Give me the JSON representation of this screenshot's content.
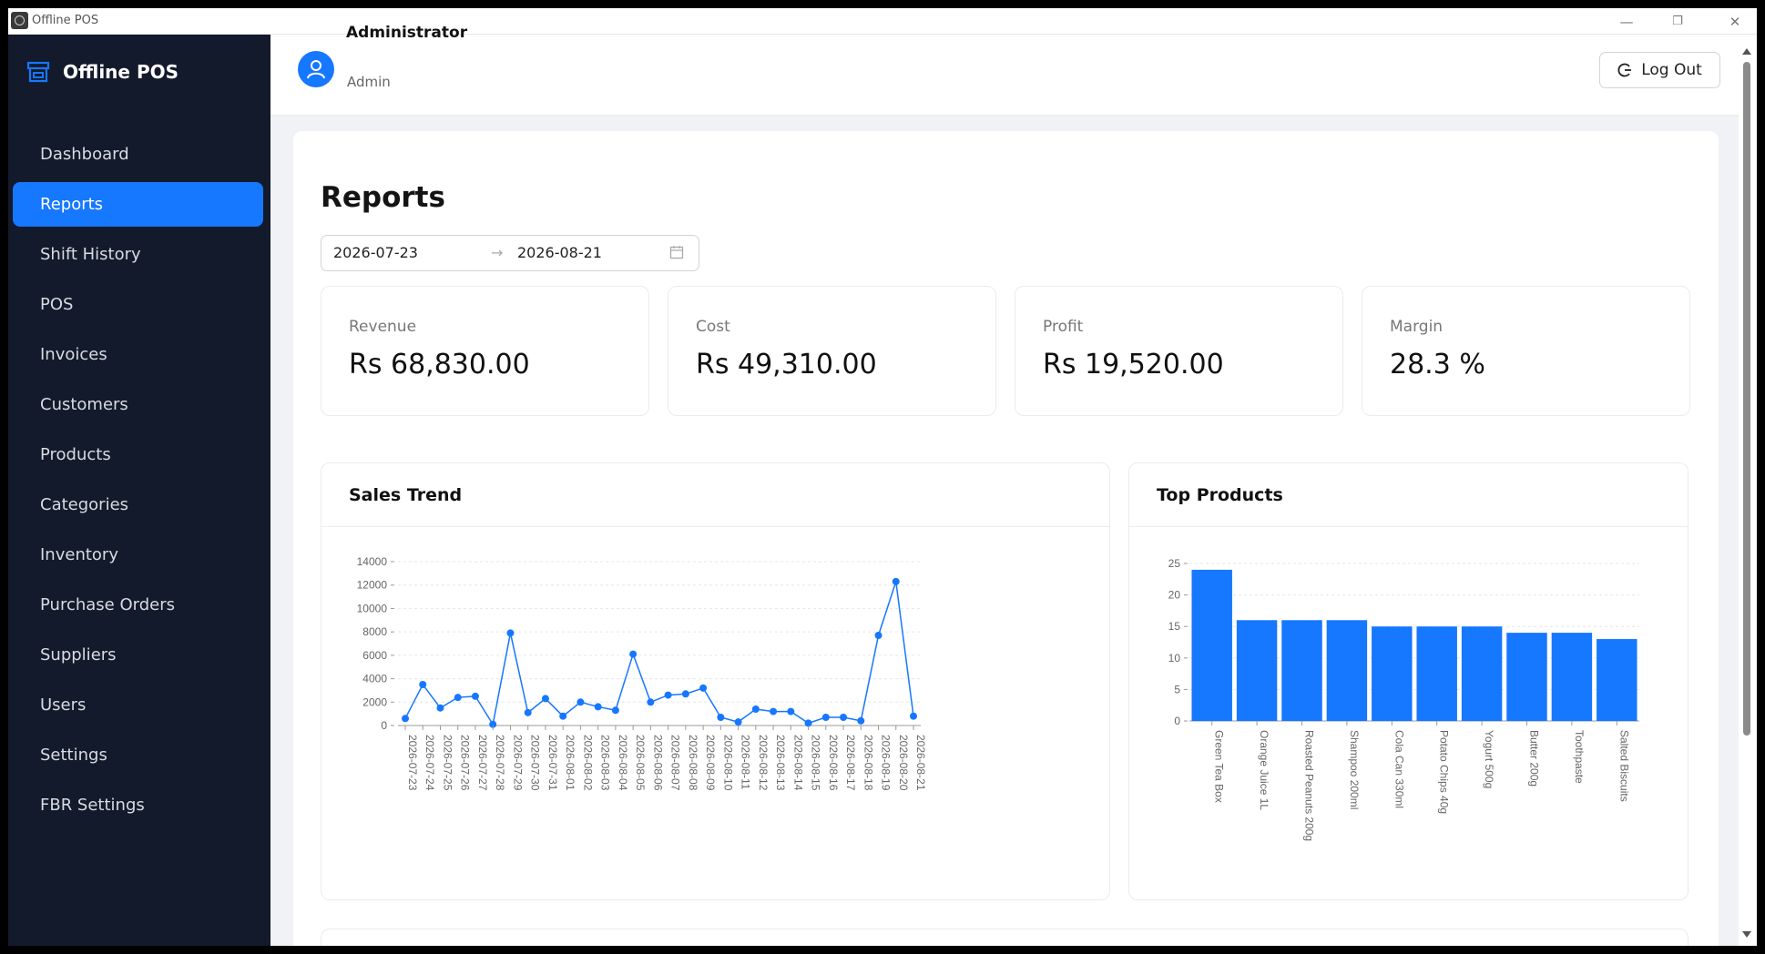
{
  "window": {
    "title": "Offline POS",
    "controls": [
      "—",
      "❐",
      "✕"
    ]
  },
  "sidebar": {
    "brand": "Offline POS",
    "items": [
      {
        "label": "Dashboard",
        "active": false
      },
      {
        "label": "Reports",
        "active": true
      },
      {
        "label": "Shift History",
        "active": false
      },
      {
        "label": "POS",
        "active": false
      },
      {
        "label": "Invoices",
        "active": false
      },
      {
        "label": "Customers",
        "active": false
      },
      {
        "label": "Products",
        "active": false
      },
      {
        "label": "Categories",
        "active": false
      },
      {
        "label": "Inventory",
        "active": false
      },
      {
        "label": "Purchase Orders",
        "active": false
      },
      {
        "label": "Suppliers",
        "active": false
      },
      {
        "label": "Users",
        "active": false
      },
      {
        "label": "Settings",
        "active": false
      },
      {
        "label": "FBR Settings",
        "active": false
      }
    ]
  },
  "header": {
    "user_name": "Administrator",
    "user_role": "Admin",
    "logout_label": "Log Out"
  },
  "page": {
    "title": "Reports",
    "date_from": "2026-07-23",
    "date_to": "2026-08-21",
    "date_separator": "→"
  },
  "stats": [
    {
      "label": "Revenue",
      "value": "Rs 68,830.00"
    },
    {
      "label": "Cost",
      "value": "Rs 49,310.00"
    },
    {
      "label": "Profit",
      "value": "Rs 19,520.00"
    },
    {
      "label": "Margin",
      "value": "28.3 %"
    }
  ],
  "colors": {
    "accent": "#1677ff",
    "sidebar_bg": "#131a2b",
    "series": "#1677ff"
  },
  "cards": {
    "sales_trend_title": "Sales Trend",
    "top_products_title": "Top Products"
  },
  "chart_data": [
    {
      "type": "line",
      "title": "Sales Trend",
      "xlabel": "",
      "ylabel": "",
      "ylim": [
        0,
        14000
      ],
      "yticks": [
        0,
        2000,
        4000,
        6000,
        8000,
        10000,
        12000,
        14000
      ],
      "grid": true,
      "x": [
        "2026-07-23",
        "2026-07-24",
        "2026-07-25",
        "2026-07-26",
        "2026-07-27",
        "2026-07-28",
        "2026-07-29",
        "2026-07-30",
        "2026-07-31",
        "2026-08-01",
        "2026-08-02",
        "2026-08-03",
        "2026-08-04",
        "2026-08-05",
        "2026-08-06",
        "2026-08-07",
        "2026-08-08",
        "2026-08-09",
        "2026-08-10",
        "2026-08-11",
        "2026-08-12",
        "2026-08-13",
        "2026-08-14",
        "2026-08-15",
        "2026-08-16",
        "2026-08-17",
        "2026-08-18",
        "2026-08-19",
        "2026-08-20",
        "2026-08-21"
      ],
      "values": [
        600,
        3500,
        1500,
        2400,
        2500,
        100,
        7900,
        1100,
        2300,
        800,
        2000,
        1600,
        1300,
        6100,
        2000,
        2600,
        2700,
        3200,
        700,
        300,
        1400,
        1200,
        1200,
        200,
        700,
        700,
        400,
        7700,
        12300,
        800
      ]
    },
    {
      "type": "bar",
      "title": "Top Products",
      "xlabel": "",
      "ylabel": "",
      "ylim": [
        0,
        25
      ],
      "yticks": [
        0,
        5,
        10,
        15,
        20,
        25
      ],
      "grid": true,
      "categories": [
        "Green Tea Box",
        "Orange Juice 1L",
        "Roasted Peanuts 200g",
        "Shampoo 200ml",
        "Cola Can 330ml",
        "Potato Chips 40g",
        "Yogurt 500g",
        "Butter 200g",
        "Toothpaste",
        "Salted Biscuits"
      ],
      "values": [
        24,
        16,
        16,
        16,
        15,
        15,
        15,
        14,
        14,
        13
      ]
    }
  ]
}
